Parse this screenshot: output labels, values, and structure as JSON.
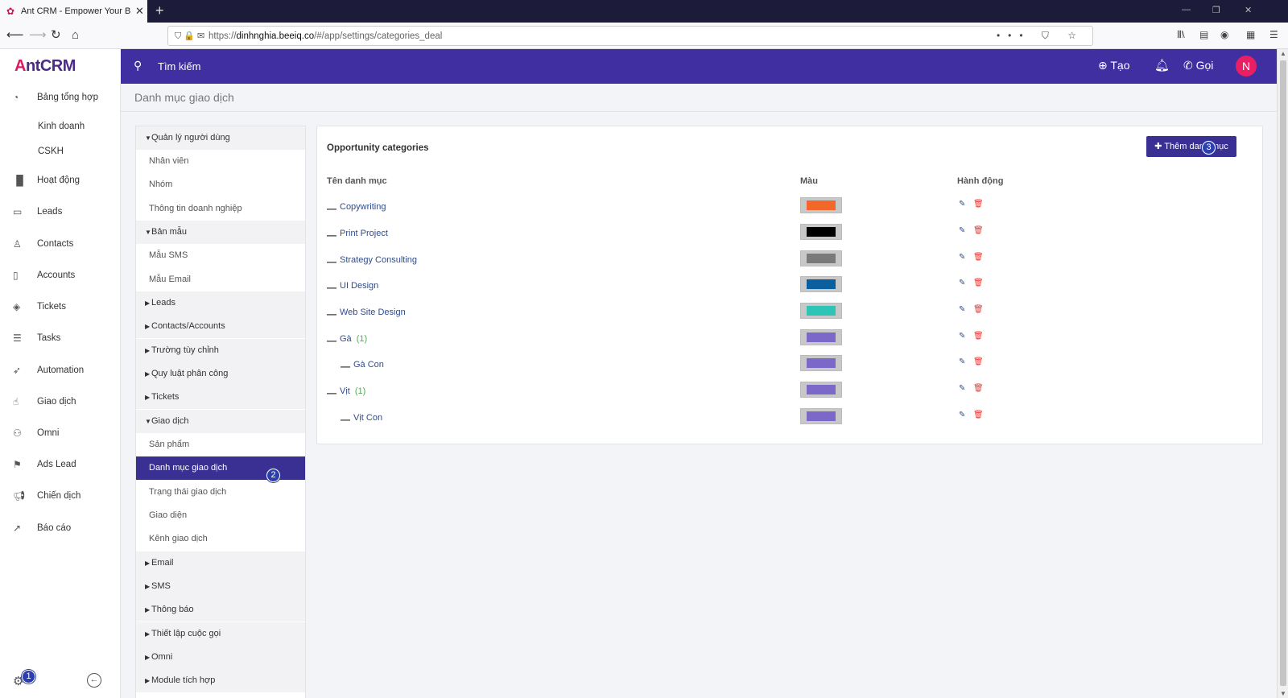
{
  "browser": {
    "tab_title": "Ant CRM - Empower Your Busi",
    "url_domain": "dinhnghia.beeiq.co",
    "url_prefix": "https://",
    "url_path": "/#/app/settings/categories_deal"
  },
  "app": {
    "logo_first": "A",
    "logo_rest": "ntCRM",
    "search_label": "Tìm kiếm",
    "create_label": "Tạo",
    "call_label": "Gọi",
    "avatar_letter": "N"
  },
  "leftnav": {
    "items": [
      {
        "label": "Bảng tổng hợp",
        "icon": "dashboard-icon"
      },
      {
        "label": "Kinh doanh",
        "icon": ""
      },
      {
        "label": "CSKH",
        "icon": ""
      },
      {
        "label": "Hoạt động",
        "icon": "activity-icon"
      },
      {
        "label": "Leads",
        "icon": "leads-icon"
      },
      {
        "label": "Contacts",
        "icon": "contacts-icon"
      },
      {
        "label": "Accounts",
        "icon": "accounts-icon"
      },
      {
        "label": "Tickets",
        "icon": "tickets-icon"
      },
      {
        "label": "Tasks",
        "icon": "tasks-icon"
      },
      {
        "label": "Automation",
        "icon": "automation-icon"
      },
      {
        "label": "Giao dịch",
        "icon": "deals-icon"
      },
      {
        "label": "Omni",
        "icon": "omni-icon"
      },
      {
        "label": "Ads Lead",
        "icon": "flag-icon"
      },
      {
        "label": "Chiến dịch",
        "icon": "megaphone-icon"
      },
      {
        "label": "Báo cáo",
        "icon": "chart-icon"
      }
    ],
    "badge_1": "1"
  },
  "page": {
    "title": "Danh mục giao dịch"
  },
  "settings_menu": {
    "groups": {
      "users": "Quản lý người dùng",
      "templates": "Bản mẫu",
      "leads": "Leads",
      "contacts": "Contacts/Accounts",
      "custom_fields": "Trường tùy chỉnh",
      "assign_rules": "Quy luật phân công",
      "tickets": "Tickets",
      "deals": "Giao dịch",
      "email": "Email",
      "sms": "SMS",
      "notifications": "Thông báo",
      "call_settings": "Thiết lập cuộc gọi",
      "omni": "Omni",
      "modules": "Module tích hợp"
    },
    "items": {
      "staff": "Nhân viên",
      "team": "Nhóm",
      "company_info": "Thông tin doanh nghiệp",
      "sms_template": "Mẫu SMS",
      "email_template": "Mẫu Email",
      "products": "Sản phẩm",
      "deal_categories": "Danh mục giao dịch",
      "deal_status": "Trạng thái giao dịch",
      "interface": "Giao diện",
      "deal_channels": "Kênh giao dịch"
    },
    "badge_2": "2"
  },
  "card": {
    "title": "Opportunity categories",
    "add_button": "Thêm danh mục",
    "badge_3": "3",
    "headers": {
      "name": "Tên danh mục",
      "color": "Màu",
      "action": "Hành động"
    },
    "rows": [
      {
        "name": "Copywriting",
        "count": "",
        "color": "#f2672a",
        "child": false
      },
      {
        "name": "Print Project",
        "count": "",
        "color": "#000000",
        "child": false
      },
      {
        "name": "Strategy Consulting",
        "count": "",
        "color": "#7a7a7a",
        "child": false
      },
      {
        "name": "UI Design",
        "count": "",
        "color": "#0b5f9e",
        "child": false
      },
      {
        "name": "Web Site Design",
        "count": "",
        "color": "#2ec4b6",
        "child": false
      },
      {
        "name": "Gà",
        "count": "(1)",
        "color": "#7b68c9",
        "child": false
      },
      {
        "name": "Gà Con",
        "count": "",
        "color": "#7b68c9",
        "child": true
      },
      {
        "name": "Vịt",
        "count": "(1)",
        "color": "#7b68c9",
        "child": false
      },
      {
        "name": "Vịt Con",
        "count": "",
        "color": "#7b68c9",
        "child": true
      }
    ]
  }
}
